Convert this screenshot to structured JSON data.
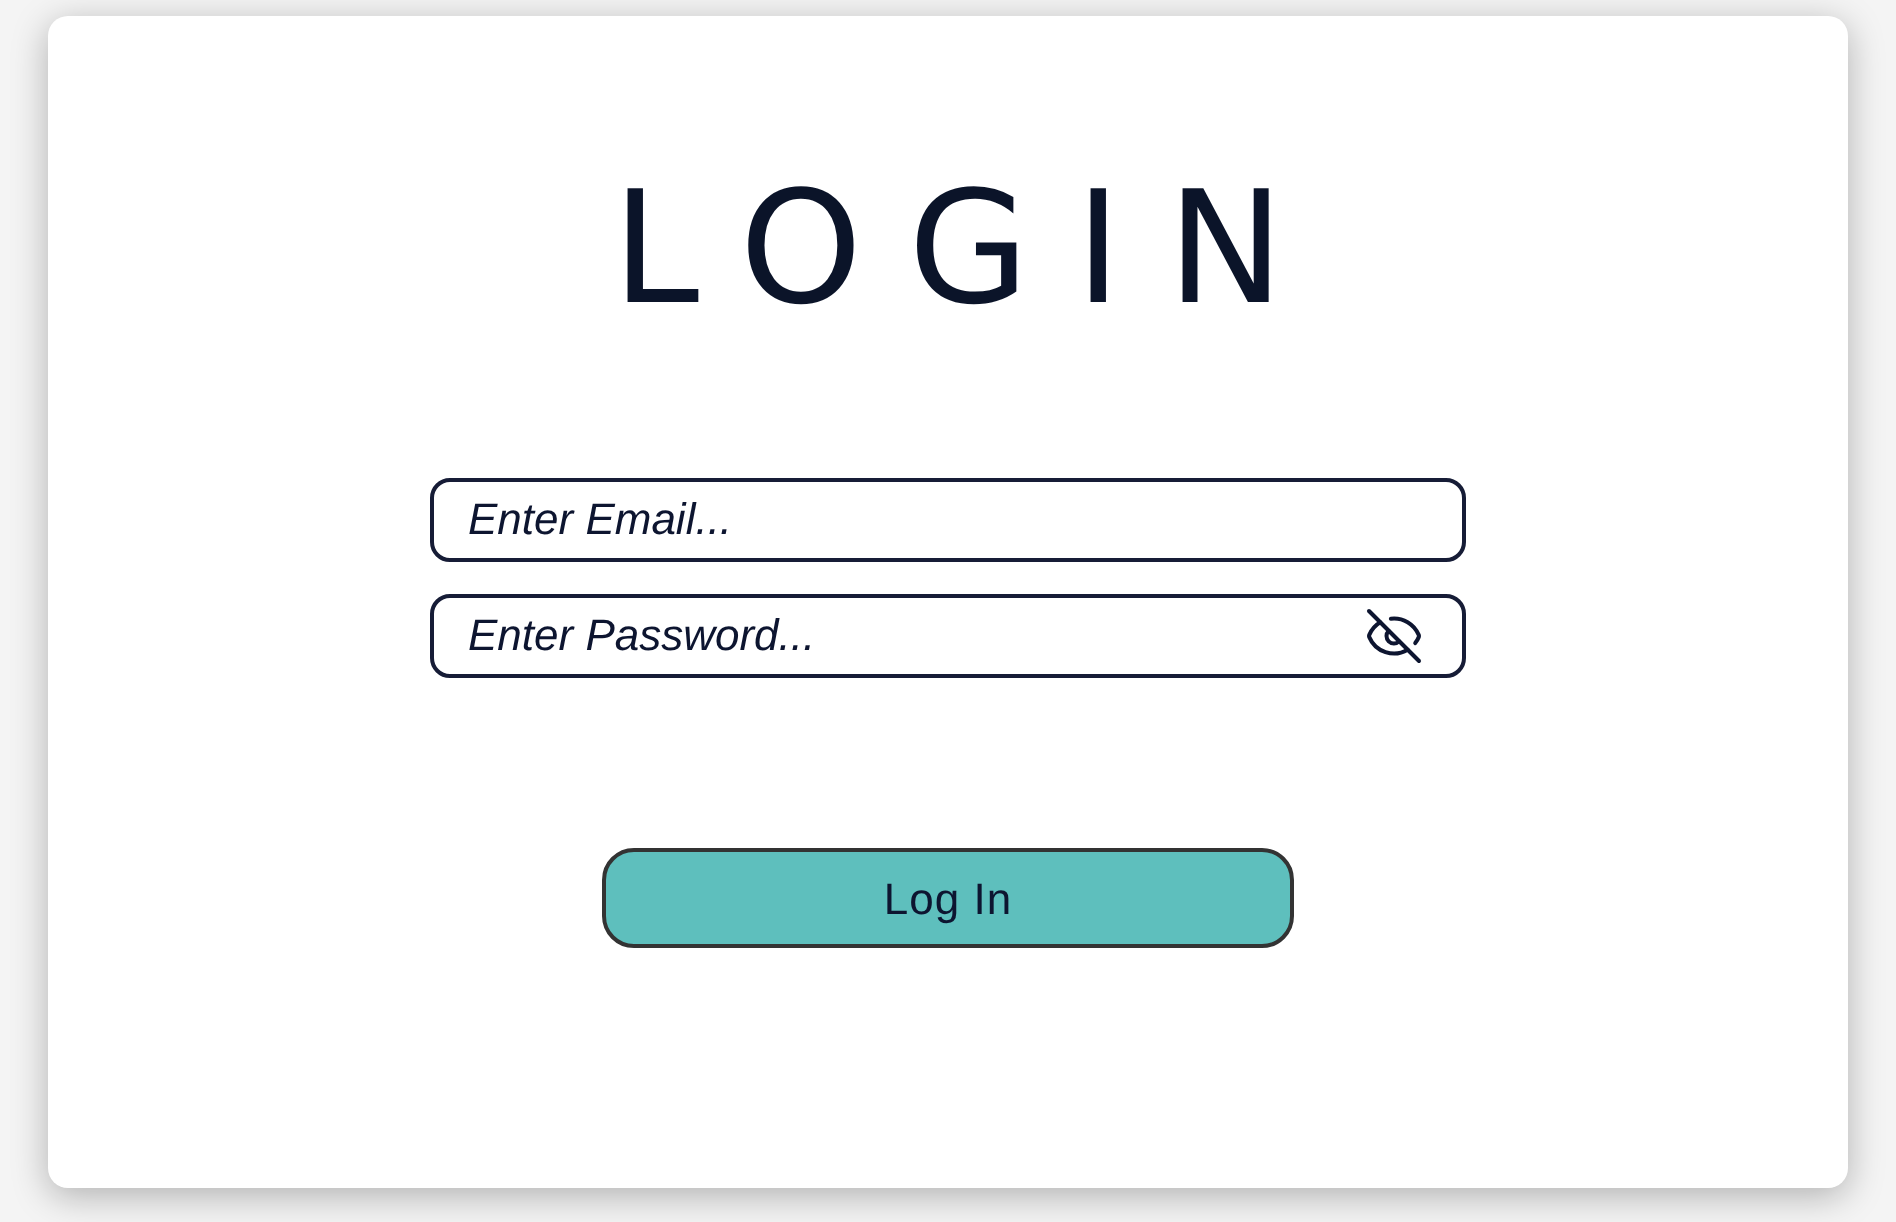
{
  "title": "LOGIN",
  "fields": [
    {
      "kind": "email",
      "placeholder": "Enter Email..."
    },
    {
      "kind": "password",
      "placeholder": "Enter Password...",
      "show_password": false
    }
  ],
  "button": {
    "label": "Log In"
  }
}
